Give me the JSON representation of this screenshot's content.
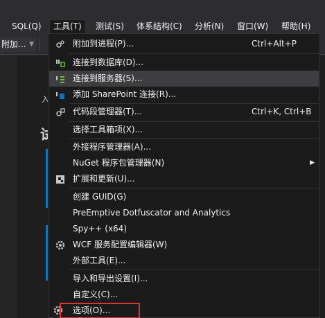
{
  "menubar": {
    "items": [
      {
        "label": "SQL(Q)"
      },
      {
        "label": "工具(T)"
      },
      {
        "label": "测试(S)"
      },
      {
        "label": "体系结构(C)"
      },
      {
        "label": "分析(N)"
      },
      {
        "label": "窗口(W)"
      },
      {
        "label": "帮助(H)"
      }
    ]
  },
  "toolbar": {
    "attach_label": "附加..."
  },
  "background": {
    "snippet_1": "入",
    "snippet_2": "试"
  },
  "tools_menu": {
    "items": [
      {
        "label": "附加到进程(P)...",
        "shortcut": "Ctrl+Alt+P",
        "icon": "attach-process-icon"
      },
      {
        "label": "连接到数据库(D)...",
        "shortcut": "",
        "icon": "connect-database-icon"
      },
      {
        "label": "连接到服务器(S)...",
        "shortcut": "",
        "icon": "connect-server-icon"
      },
      {
        "label": "添加 SharePoint 连接(R)...",
        "shortcut": "",
        "icon": "sharepoint-icon"
      },
      {
        "label": "代码段管理器(T)...",
        "shortcut": "Ctrl+K, Ctrl+B",
        "icon": "code-snippet-icon"
      },
      {
        "label": "选择工具箱项(X)...",
        "shortcut": "",
        "icon": ""
      },
      {
        "label": "外接程序管理器(A)...",
        "shortcut": "",
        "icon": ""
      },
      {
        "label": "NuGet 程序包管理器(N)",
        "shortcut": "",
        "icon": "",
        "submenu": true
      },
      {
        "label": "扩展和更新(U)...",
        "shortcut": "",
        "icon": "extensions-icon"
      },
      {
        "label": "创建 GUID(G)",
        "shortcut": "",
        "icon": ""
      },
      {
        "label": "PreEmptive Dotfuscator and Analytics",
        "shortcut": "",
        "icon": ""
      },
      {
        "label": "Spy++ (x64)",
        "shortcut": "",
        "icon": ""
      },
      {
        "label": "WCF 服务配置编辑器(W)",
        "shortcut": "",
        "icon": "wcf-gear-icon"
      },
      {
        "label": "外部工具(E)...",
        "shortcut": "",
        "icon": ""
      },
      {
        "label": "导入和导出设置(I)...",
        "shortcut": "",
        "icon": ""
      },
      {
        "label": "自定义(C)...",
        "shortcut": "",
        "icon": ""
      },
      {
        "label": "选项(O)...",
        "shortcut": "",
        "icon": "options-gear-icon"
      }
    ]
  },
  "colors": {
    "menu_bg": "#1b1b1c",
    "hover_bg": "#3e3e40",
    "accent": "#007acc",
    "highlight_border": "#e0342f"
  }
}
